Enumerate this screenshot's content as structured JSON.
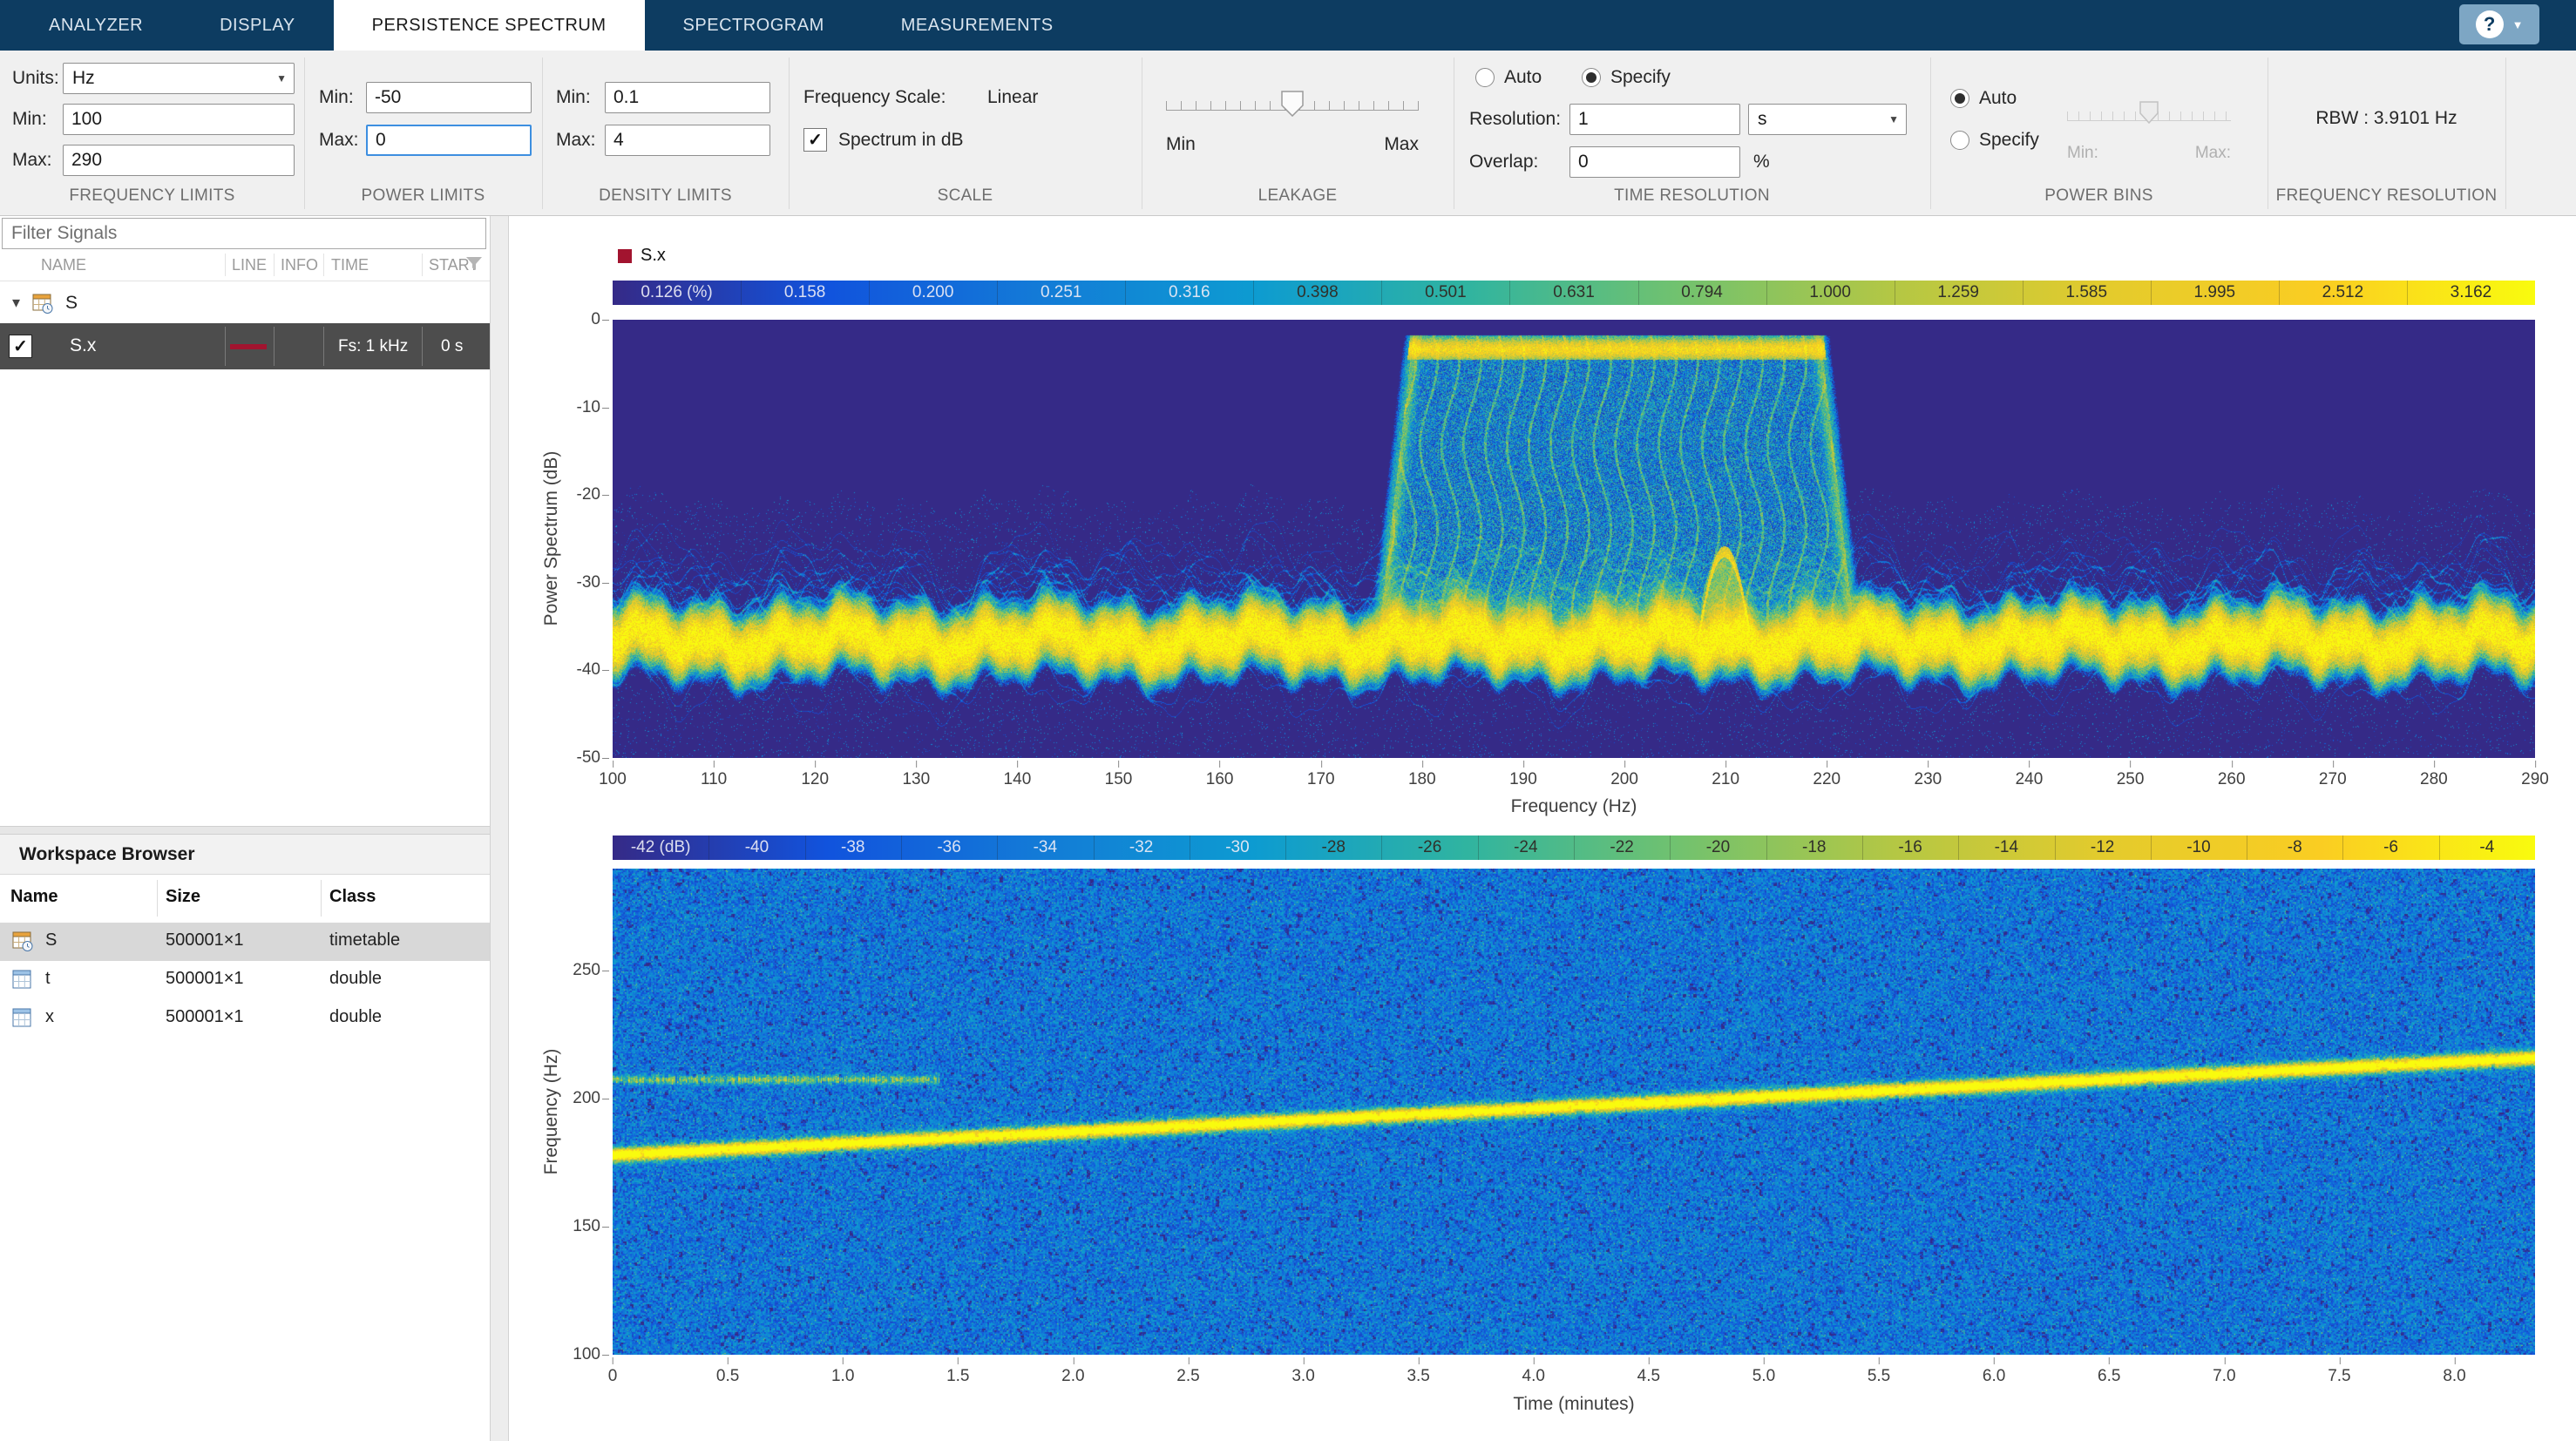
{
  "icons": {
    "caret_down": "▼",
    "check": "✓",
    "triangle_down": "▾",
    "question": "?",
    "chevron_up": "⌃"
  },
  "colormap": {
    "name": "parula",
    "stops": [
      "#352a87",
      "#1153dd",
      "#137bd7",
      "#0d9bd1",
      "#30b4a0",
      "#72c26e",
      "#b4c744",
      "#e4cb2c",
      "#facd22",
      "#f9fb0e"
    ]
  },
  "tabs": {
    "items": [
      {
        "label": "ANALYZER"
      },
      {
        "label": "DISPLAY"
      },
      {
        "label": "PERSISTENCE SPECTRUM"
      },
      {
        "label": "SPECTROGRAM"
      },
      {
        "label": "MEASUREMENTS"
      }
    ],
    "active_index": 2
  },
  "ribbon": {
    "frequency_limits": {
      "title": "FREQUENCY LIMITS",
      "units_label": "Units:",
      "units_value": "Hz",
      "min_label": "Min:",
      "min_value": "100",
      "max_label": "Max:",
      "max_value": "290"
    },
    "power_limits": {
      "title": "POWER LIMITS",
      "min_label": "Min:",
      "min_value": "-50",
      "max_label": "Max:",
      "max_value": "0"
    },
    "density_limits": {
      "title": "DENSITY LIMITS",
      "min_label": "Min:",
      "min_value": "0.1",
      "max_label": "Max:",
      "max_value": "4"
    },
    "scale": {
      "title": "SCALE",
      "freq_scale_label": "Frequency Scale:",
      "freq_scale_value": "Linear",
      "spectrum_db_label": "Spectrum in dB",
      "spectrum_db_checked": true
    },
    "leakage": {
      "title": "LEAKAGE",
      "min_label": "Min",
      "max_label": "Max",
      "value_pct": 50
    },
    "time_resolution": {
      "title": "TIME RESOLUTION",
      "auto_label": "Auto",
      "specify_label": "Specify",
      "selected": "Specify",
      "resolution_label": "Resolution:",
      "resolution_value": "1",
      "resolution_units": "s",
      "overlap_label": "Overlap:",
      "overlap_value": "0",
      "overlap_units": "%"
    },
    "power_bins": {
      "title": "POWER BINS",
      "auto_label": "Auto",
      "specify_label": "Specify",
      "selected": "Auto",
      "min_label": "Min:",
      "max_label": "Max:",
      "value_pct": 50
    },
    "frequency_resolution": {
      "title": "FREQUENCY RESOLUTION",
      "rbw_text": "RBW : 3.9101 Hz"
    }
  },
  "signals_panel": {
    "filter_placeholder": "Filter Signals",
    "columns": [
      "NAME",
      "LINE",
      "INFO",
      "TIME",
      "START"
    ],
    "group_row": {
      "name": "S"
    },
    "signal_row": {
      "name": "S.x",
      "checked": true,
      "line_color": "#a2142f",
      "fs": "Fs: 1 kHz",
      "start": "0 s"
    }
  },
  "workspace": {
    "title": "Workspace Browser",
    "columns": [
      "Name",
      "Size",
      "Class"
    ],
    "rows": [
      {
        "name": "S",
        "size": "500001×1",
        "class": "timetable",
        "selected": true
      },
      {
        "name": "t",
        "size": "500001×1",
        "class": "double",
        "selected": false
      },
      {
        "name": "x",
        "size": "500001×1",
        "class": "double",
        "selected": false
      }
    ]
  },
  "chart_data": [
    {
      "type": "heatmap",
      "name": "persistence-spectrum",
      "legend_label": "S.x",
      "legend_color": "#a2142f",
      "xlabel": "Frequency (Hz)",
      "ylabel": "Power Spectrum (dB)",
      "xlim": [
        100,
        290
      ],
      "ylim": [
        -50,
        0
      ],
      "xticks": [
        100,
        110,
        120,
        130,
        140,
        150,
        160,
        170,
        180,
        190,
        200,
        210,
        220,
        230,
        240,
        250,
        260,
        270,
        280,
        290
      ],
      "yticks": [
        0,
        -10,
        -20,
        -30,
        -40,
        -50
      ],
      "colorbar_labels": [
        "0.126 (%)",
        "0.158",
        "0.200",
        "0.251",
        "0.316",
        "0.398",
        "0.501",
        "0.631",
        "0.794",
        "1.000",
        "1.259",
        "1.585",
        "1.995",
        "2.512",
        "3.162"
      ],
      "density_range_pct": [
        0.126,
        3.162
      ],
      "grid": false,
      "legend_position": "top-left",
      "features": {
        "noise_floor_db": -36.6,
        "signal_top_band_hz": [
          179,
          219.5
        ],
        "signal_top_db": -3,
        "edge_flare_hz_per_db": 0.1,
        "transient_peak_hz": 209.9,
        "transient_peak_db": -26.5
      }
    },
    {
      "type": "heatmap",
      "name": "spectrogram",
      "xlabel": "Time (minutes)",
      "ylabel": "Frequency (Hz)",
      "xlim": [
        0,
        8.35
      ],
      "ylim": [
        100,
        290
      ],
      "xticks": [
        "0",
        "0.5",
        "1.0",
        "1.5",
        "2.0",
        "2.5",
        "3.0",
        "3.5",
        "4.0",
        "4.5",
        "5.0",
        "5.5",
        "6.0",
        "6.5",
        "7.0",
        "7.5",
        "8.0"
      ],
      "yticks": [
        100,
        150,
        200,
        250
      ],
      "colorbar_labels": [
        "-42 (dB)",
        "-40",
        "-38",
        "-36",
        "-34",
        "-32",
        "-30",
        "-28",
        "-26",
        "-24",
        "-22",
        "-20",
        "-18",
        "-16",
        "-14",
        "-12",
        "-10",
        "-8",
        "-6",
        "-4"
      ],
      "value_range_db": [
        -42,
        -4
      ],
      "grid": false,
      "features": {
        "background_db": -34,
        "chirp_start_hz": 178,
        "chirp_end_hz": 216,
        "tone_hz": 207.5,
        "tone_end_min": 1.42
      }
    }
  ]
}
